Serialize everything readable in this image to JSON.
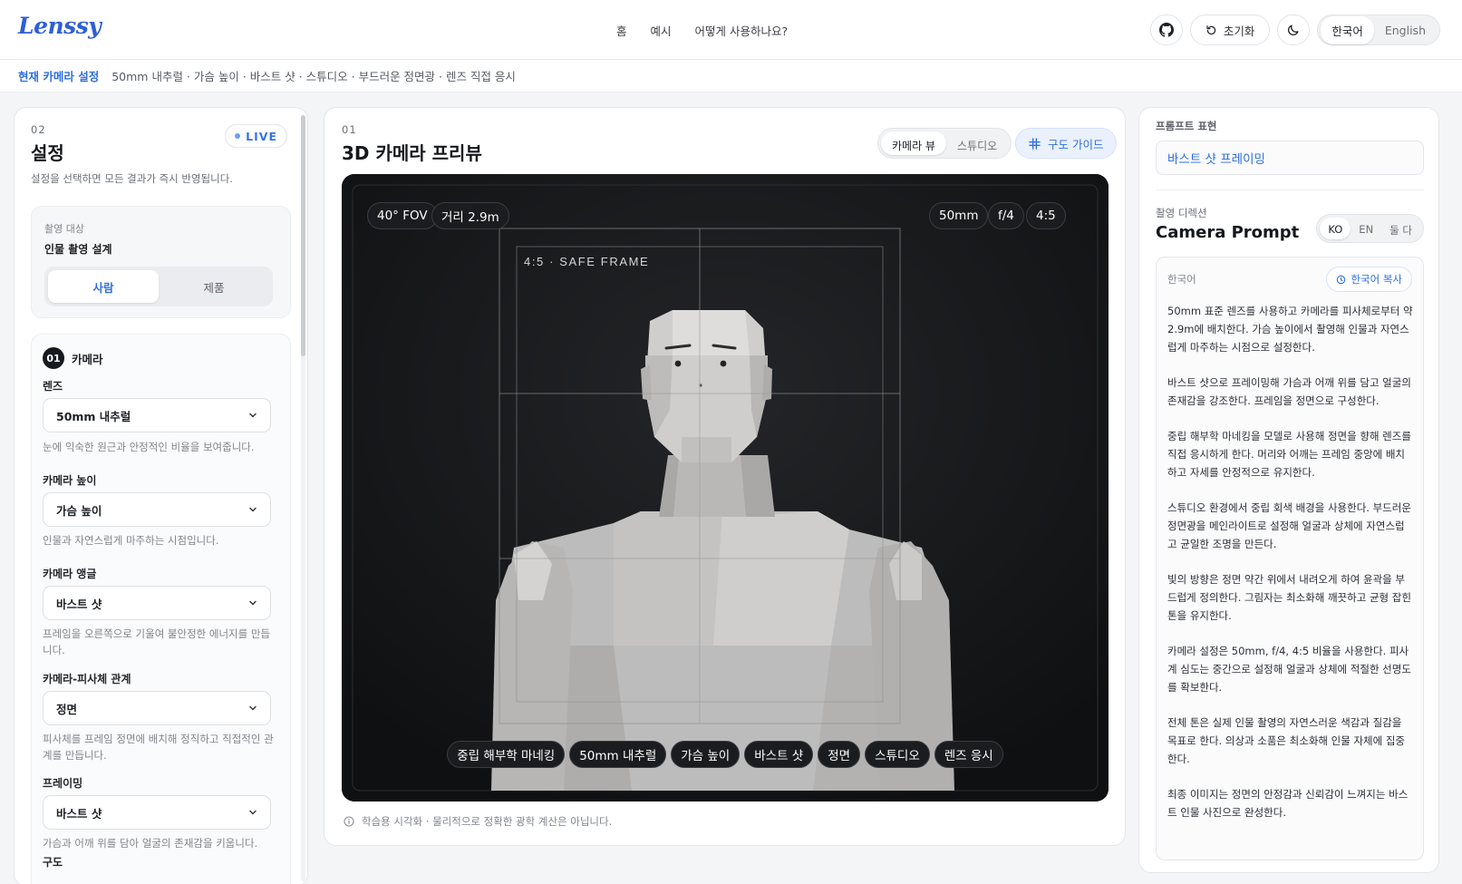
{
  "header": {
    "logo": "Lenssy",
    "nav": [
      "홈",
      "예시",
      "어떻게 사용하나요?"
    ],
    "reset_label": "초기화",
    "lang": [
      "한국어",
      "English"
    ]
  },
  "strip": {
    "label": "현재 카메라 설정",
    "value": "50mm 내추럴 · 가슴 높이 · 바스트 샷 · 스튜디오 · 부드러운 정면광 · 렌즈 직접 응시"
  },
  "settings": {
    "num": "02",
    "title": "설정",
    "desc": "설정을 선택하면 모든 결과가 즉시 반영됩니다.",
    "live": "LIVE",
    "target_small": "촬영 대상",
    "target_bold": "인물 촬영 설계",
    "target_options": [
      "사람",
      "제품"
    ],
    "step_num": "01",
    "step_title": "카메라",
    "fields": [
      {
        "label": "렌즈",
        "value": "50mm 내추럴",
        "help": "눈에 익숙한 원근과 안정적인 비율을 보여줍니다."
      },
      {
        "label": "카메라 높이",
        "value": "가슴 높이",
        "help": "인물과 자연스럽게 마주하는 시점입니다."
      },
      {
        "label": "카메라 앵글",
        "value": "바스트 샷",
        "help": "프레임을 오른쪽으로 기울여 불안정한 에너지를 만듭니다."
      },
      {
        "label": "카메라-피사체 관계",
        "value": "정면",
        "help": "피사체를 프레임 정면에 배치해 정직하고 직접적인 관계를 만듭니다."
      },
      {
        "label": "프레이밍",
        "value": "바스트 샷",
        "help": "가슴과 어깨 위를 담아 얼굴의 존재감을 키웁니다."
      }
    ],
    "next_label": "구도"
  },
  "preview": {
    "num": "01",
    "title": "3D 카메라 프리뷰",
    "view_options": [
      "카메라 뷰",
      "스튜디오"
    ],
    "guide_label": "구도 가이드",
    "chips_left": [
      "40° FOV",
      "거리 2.9m"
    ],
    "chips_right": [
      "50mm",
      "f/4",
      "4:5"
    ],
    "safe_frame": "4:5 · SAFE FRAME",
    "bottom_chips": [
      "중립 해부학 마네킹",
      "50mm 내추럴",
      "가슴 높이",
      "바스트 샷",
      "정면",
      "스튜디오",
      "렌즈 응시"
    ],
    "footnote": "학습용 시각화 · 물리적으로 정확한 광학 계산은 아닙니다."
  },
  "prompt": {
    "expr_label": "프롬프트 표현",
    "expr_value": "바스트 샷 프레이밍",
    "direction_label": "촬영 디렉션",
    "title": "Camera Prompt",
    "lang_options": [
      "KO",
      "EN",
      "둘 다"
    ],
    "box_lang": "한국어",
    "copy_label": "한국어 복사",
    "paragraphs": [
      "50mm 표준 렌즈를 사용하고 카메라를 피사체로부터 약 2.9m에 배치한다. 가슴 높이에서 촬영해 인물과 자연스럽게 마주하는 시점으로 설정한다.",
      "바스트 샷으로 프레이밍해 가슴과 어깨 위를 담고 얼굴의 존재감을 강조한다. 프레임을 정면으로 구성한다.",
      "중립 해부학 마네킹을 모델로 사용해 정면을 향해 렌즈를 직접 응시하게 한다. 머리와 어깨는 프레임 중앙에 배치하고 자세를 안정적으로 유지한다.",
      "스튜디오 환경에서 중립 회색 배경을 사용한다. 부드러운 정면광을 메인라이트로 설정해 얼굴과 상체에 자연스럽고 균일한 조명을 만든다.",
      "빛의 방향은 정면 약간 위에서 내려오게 하여 윤곽을 부드럽게 정의한다. 그림자는 최소화해 깨끗하고 균형 잡힌 톤을 유지한다.",
      "카메라 설정은 50mm, f/4, 4:5 비율을 사용한다. 피사계 심도는 중간으로 설정해 얼굴과 상체에 적절한 선명도를 확보한다.",
      "전체 톤은 실제 인물 촬영의 자연스러운 색감과 질감을 목표로 한다. 의상과 소품은 최소화해 인물 자체에 집중한다.",
      "최종 이미지는 정면의 안정감과 신뢰감이 느껴지는 바스트 인물 사진으로 완성한다."
    ]
  },
  "colors": {
    "accent": "#2f6fe0",
    "viewport_bg": "#111214"
  }
}
